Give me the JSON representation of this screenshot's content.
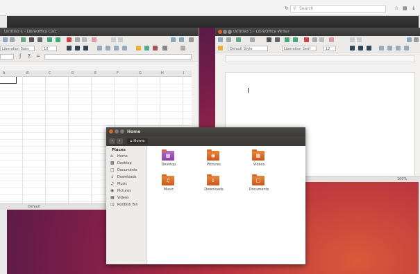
{
  "browser": {
    "search_placeholder": "Search",
    "reload_icon": "reload-icon",
    "toolbar_icons": [
      "star-icon",
      "bookmark-icon",
      "download-icon"
    ]
  },
  "calc": {
    "title": "Untitled 1 - LibreOffice Calc",
    "font_name": "Liberation Sans",
    "font_size": "10",
    "columns": [
      "A",
      "B",
      "C",
      "D",
      "E",
      "F",
      "G",
      "H",
      "I"
    ],
    "sheet_status": "Default"
  },
  "writer": {
    "title": "Untitled 1 - LibreOffice Writer",
    "paragraph_style": "Default Style",
    "font_name": "Liberation Serif",
    "font_size": "12",
    "zoom": "100%"
  },
  "files": {
    "title": "Home",
    "breadcrumb": "Home",
    "sidebar_heading": "Places",
    "places": [
      {
        "label": "Home",
        "icon": "home-icon"
      },
      {
        "label": "Desktop",
        "icon": "desktop-icon"
      },
      {
        "label": "Documents",
        "icon": "documents-icon"
      },
      {
        "label": "Downloads",
        "icon": "downloads-icon"
      },
      {
        "label": "Music",
        "icon": "music-icon"
      },
      {
        "label": "Pictures",
        "icon": "pictures-icon"
      },
      {
        "label": "Videos",
        "icon": "videos-icon"
      },
      {
        "label": "Rubbish Bin",
        "icon": "trash-icon"
      }
    ],
    "folders": [
      {
        "label": "Desktop",
        "icon": "desktop-folder-icon"
      },
      {
        "label": "Pictures",
        "icon": "pictures-folder-icon"
      },
      {
        "label": "Videos",
        "icon": "videos-folder-icon"
      },
      {
        "label": "Music",
        "icon": "music-folder-icon"
      },
      {
        "label": "Downloads",
        "icon": "downloads-folder-icon"
      },
      {
        "label": "Documents",
        "icon": "documents-folder-icon"
      }
    ]
  },
  "colors": {
    "accent_orange": "#dd4814",
    "titlebar_dark": "#3c3b37",
    "close_button": "#e05d2c"
  }
}
